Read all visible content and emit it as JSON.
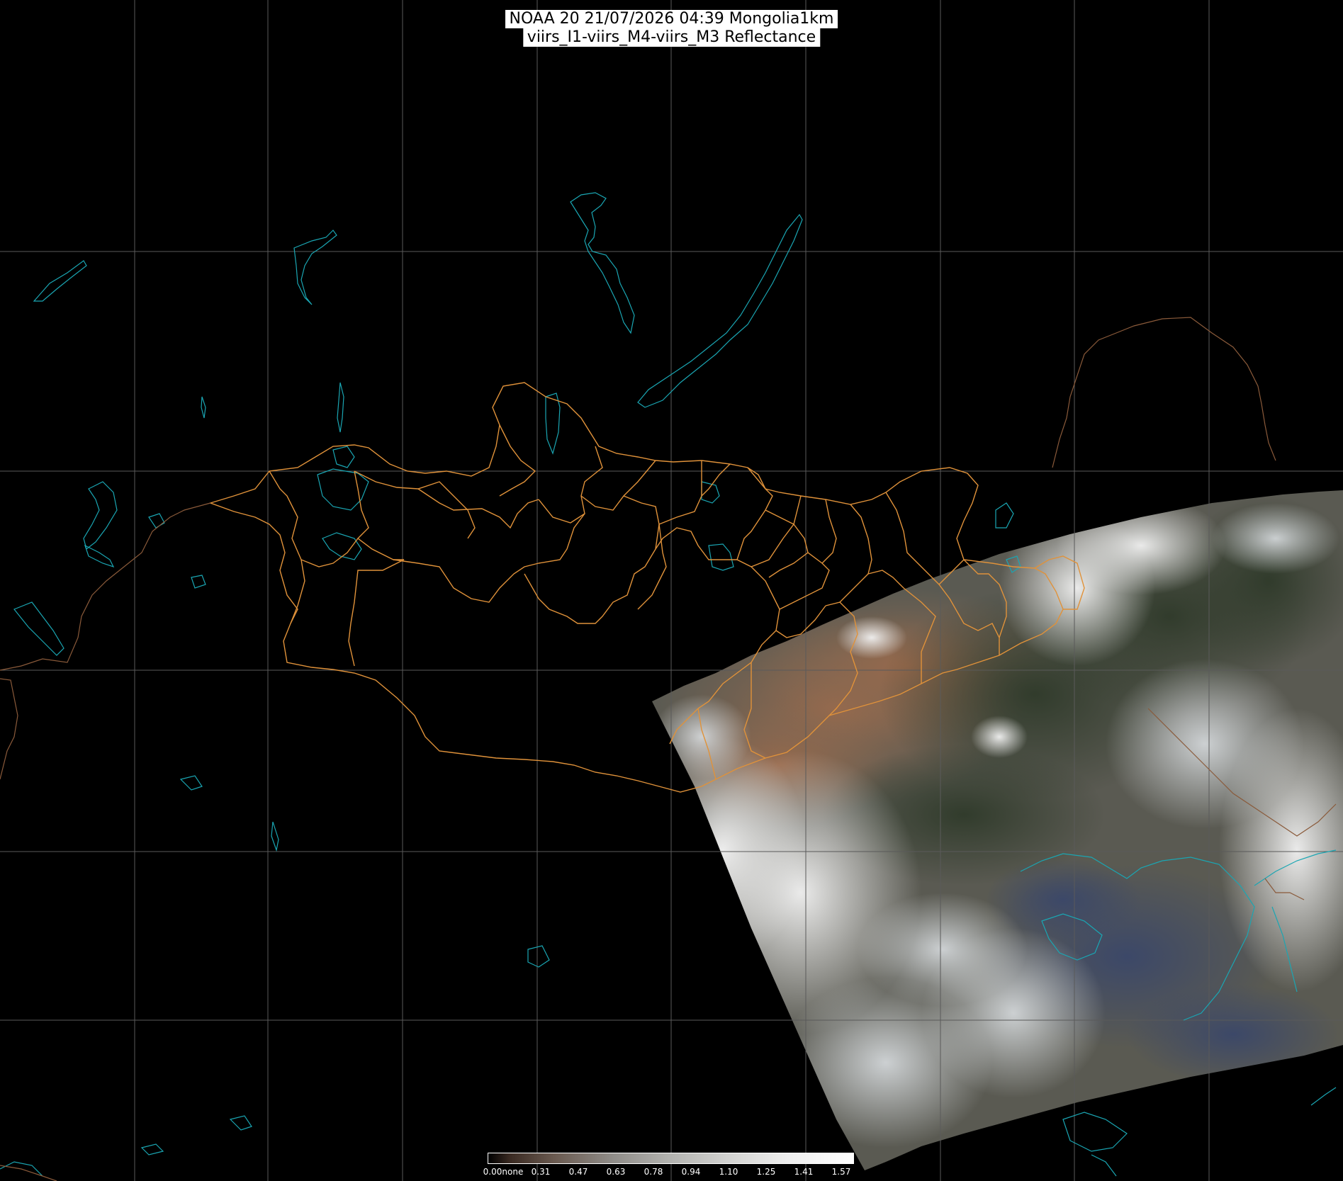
{
  "title": {
    "line1": "NOAA 20 21/07/2026 04:39 Mongolia1km",
    "line2": "viirs_I1-viirs_M4-viirs_M3 Reflectance"
  },
  "colorbar": {
    "labels": [
      "0.00none",
      "0.31",
      "0.47",
      "0.63",
      "0.78",
      "0.94",
      "1.10",
      "1.25",
      "1.41",
      "1.57"
    ]
  },
  "colors": {
    "background": "#000000",
    "grid": "#5a5a5a",
    "borders": "#e0923a",
    "water": "#1aa6b3"
  }
}
